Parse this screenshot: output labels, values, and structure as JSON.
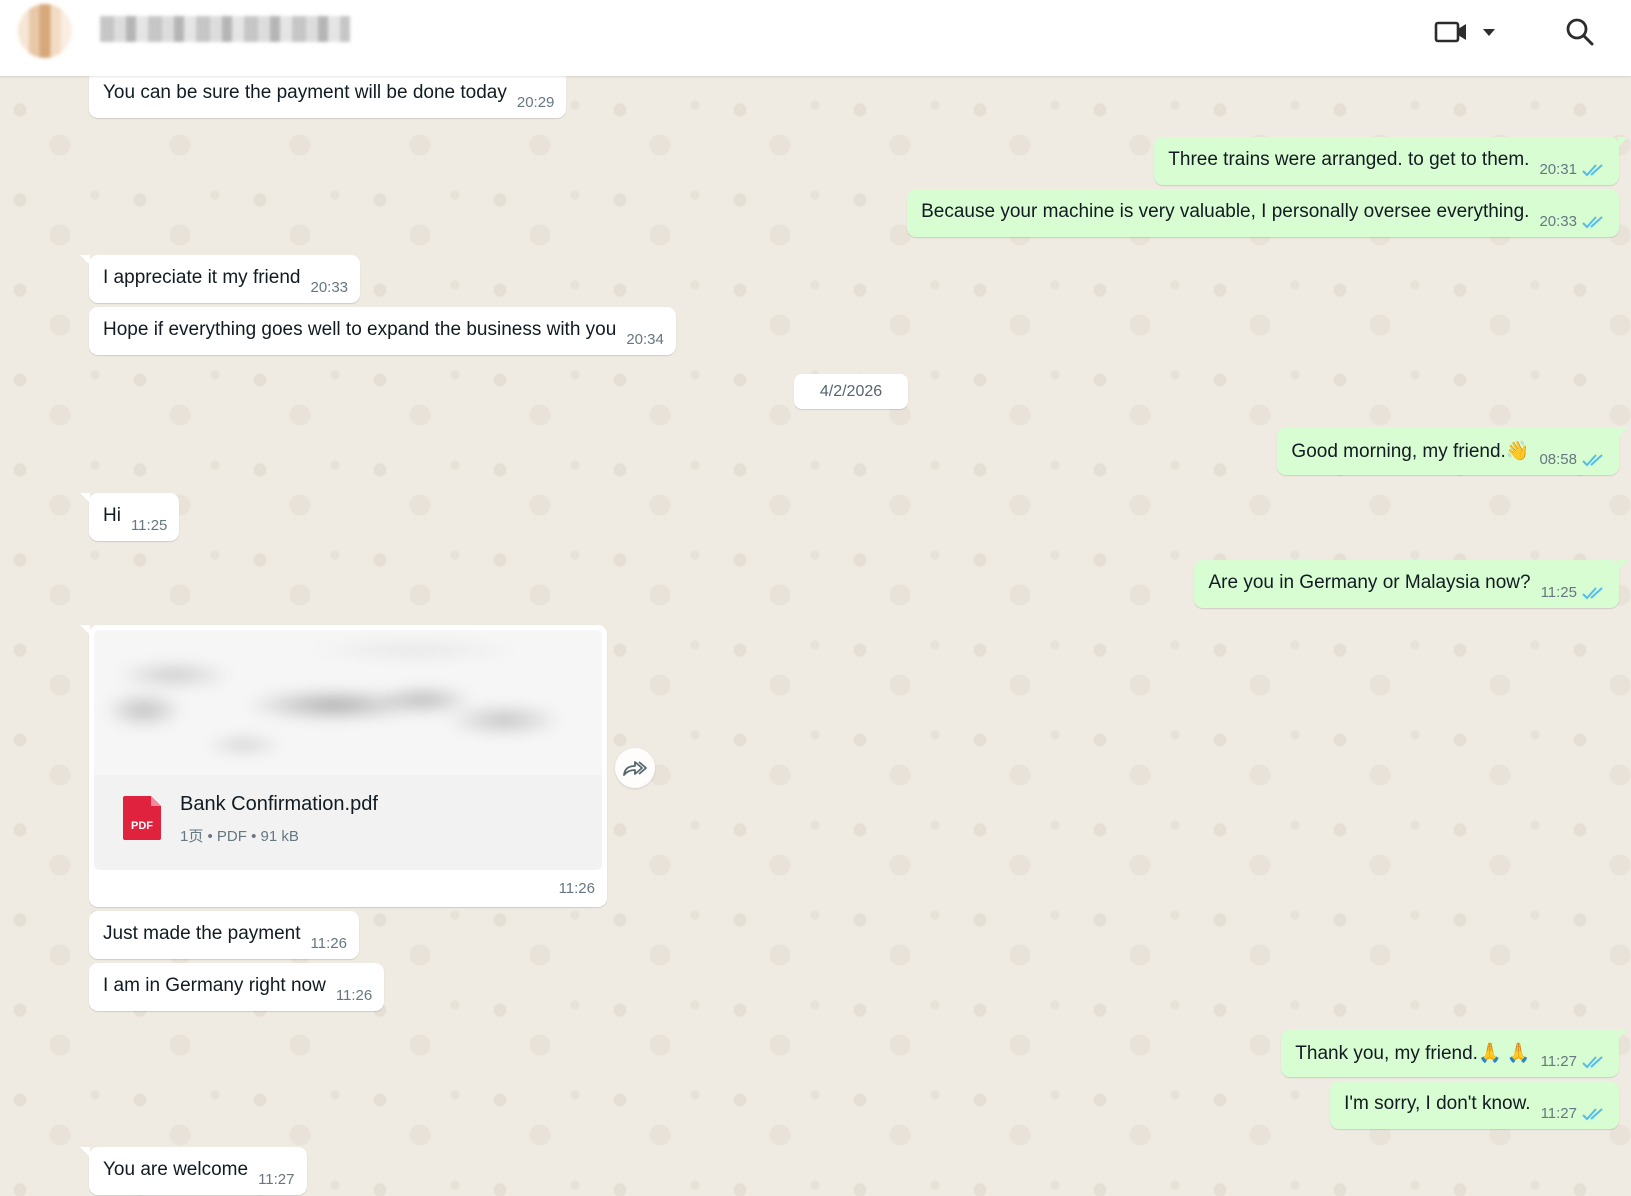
{
  "header": {
    "video_icon": "video-camera-icon",
    "dropdown_icon": "chevron-down-icon",
    "search_icon": "search-icon"
  },
  "colors": {
    "incoming_bubble": "#ffffff",
    "outgoing_bubble": "#d9fdd3",
    "read_ticks": "#53bdeb",
    "pdf_red": "#e1223e",
    "chat_background": "#efeae2"
  },
  "messages": [
    {
      "dir": "in",
      "text": "You can be sure the payment will be done today",
      "time": "20:29"
    },
    {
      "dir": "out",
      "text": "Three trains were arranged. to get to them.",
      "time": "20:31",
      "ticks": "double-check-read-icon"
    },
    {
      "dir": "out",
      "text": "Because your machine is very valuable, I personally oversee everything.",
      "time": "20:33",
      "ticks": "double-check-read-icon"
    },
    {
      "dir": "in",
      "text": "I appreciate it my friend",
      "time": "20:33"
    },
    {
      "dir": "in",
      "text": "Hope if everything goes well to expand the business with you",
      "time": "20:34"
    },
    {
      "dir": "out",
      "text": "Good morning, my friend.👋",
      "time": "08:58",
      "ticks": "double-check-read-icon"
    },
    {
      "dir": "in",
      "text": "Hi",
      "time": "11:25"
    },
    {
      "dir": "out",
      "text": "Are you in Germany or Malaysia now?",
      "time": "11:25",
      "ticks": "double-check-read-icon"
    },
    {
      "dir": "in",
      "text": "Just made the payment",
      "time": "11:26"
    },
    {
      "dir": "in",
      "text": "I am in Germany right now",
      "time": "11:26"
    },
    {
      "dir": "out",
      "text": "Thank you, my friend.🙏 🙏",
      "time": "11:27",
      "ticks": "double-check-read-icon"
    },
    {
      "dir": "out",
      "text": "I'm sorry, I don't know.",
      "time": "11:27",
      "ticks": "double-check-read-icon"
    },
    {
      "dir": "in",
      "text": "You are welcome",
      "time": "11:27"
    }
  ],
  "date_separator": "4/2/2026",
  "document": {
    "file_name": "Bank Confirmation.pdf",
    "meta": "1页 • PDF • 91 kB",
    "time": "11:26",
    "file_icon": "pdf-file-icon",
    "icon_label": "PDF",
    "forward_icon": "forward-icon"
  }
}
